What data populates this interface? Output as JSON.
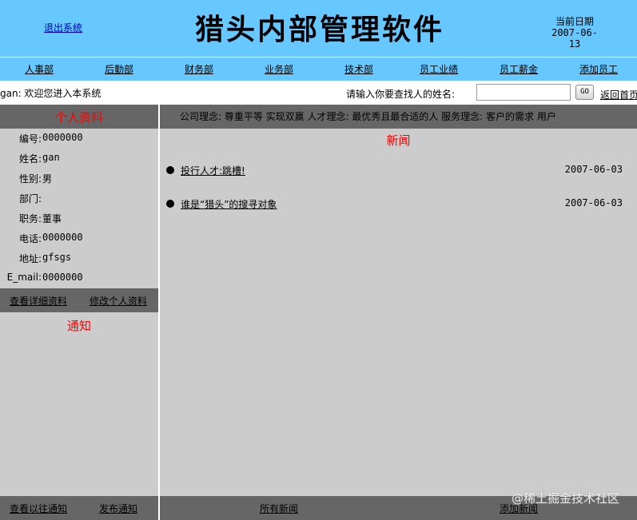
{
  "header": {
    "logout_label": "退出系统",
    "title": "猎头内部管理软件",
    "date_label": "当前日期",
    "date_value": "2007-06-13"
  },
  "nav": {
    "items": [
      "人事部",
      "后勤部",
      "财务部",
      "业务部",
      "技术部",
      "员工业绩",
      "员工薪金",
      "添加员工"
    ]
  },
  "search": {
    "welcome": "gan: 欢迎您进入本系统",
    "label": "请输入你要查找人的姓名:",
    "input_value": "",
    "go_label": "GO",
    "home_label": "返回首页"
  },
  "profile": {
    "heading": "个人资料",
    "fields": [
      {
        "label": "编号:",
        "value": "0000000"
      },
      {
        "label": "姓名:",
        "value": "gan"
      },
      {
        "label": "性别:",
        "value": "男"
      },
      {
        "label": "部门:",
        "value": ""
      },
      {
        "label": "职务:",
        "value": "董事"
      },
      {
        "label": "电话:",
        "value": "0000000"
      },
      {
        "label": "地址:",
        "value": "gfsgs"
      },
      {
        "label": "E_mail:",
        "value": "0000000"
      }
    ],
    "view_detail_label": "查看详细资料",
    "edit_label": "修改个人资料"
  },
  "notice": {
    "heading": "通知",
    "history_label": "查看以往通知",
    "publish_label": "发布通知"
  },
  "ticker": {
    "text": "公司理念: 尊重平等 实现双赢   人才理念: 最优秀且最合适的人   服务理念: 客户的需求 用户"
  },
  "news": {
    "heading": "新闻",
    "items": [
      {
        "title": "投行人才:跳槽!",
        "date": "2007-06-03"
      },
      {
        "title": "谁是“猎头”的搜寻对象",
        "date": "2007-06-03"
      }
    ],
    "all_label": "所有新闻",
    "add_label": "添加新闻"
  },
  "watermark": "@稀土掘金技术社区",
  "colors": {
    "header_bg": "#66c8ff",
    "panel_bg": "#cccccc",
    "bar_bg": "#666666",
    "heading_red": "#ff0000"
  }
}
